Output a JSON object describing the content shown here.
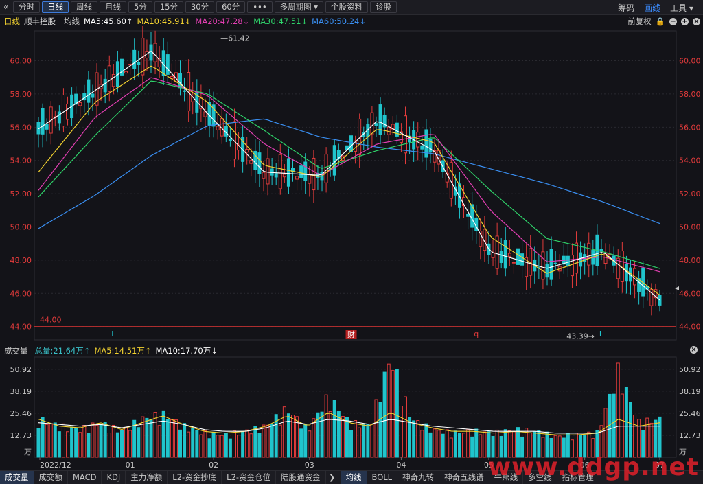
{
  "toolbar": {
    "tabs": [
      "分时",
      "日线",
      "周线",
      "月线",
      "5分",
      "15分",
      "30分",
      "60分",
      "•••",
      "多周期图 ▾",
      "个股资料",
      "诊股"
    ],
    "active_tab": 1,
    "right_items": [
      "筹码",
      "画线",
      "工具 ▾"
    ]
  },
  "header": {
    "period": "日线",
    "stock_name": "顺丰控股",
    "avg_label": "均线",
    "ma5": "MA5:45.60↑",
    "ma10": "MA10:45.91↓",
    "ma20": "MA20:47.28↓",
    "ma30": "MA30:47.51↓",
    "ma60": "MA60:50.24↓",
    "adjust": "前复权",
    "colors": {
      "ma5": "#ffffff",
      "ma10": "#f2d230",
      "ma20": "#e23fb2",
      "ma30": "#2fd36a",
      "ma60": "#3a8ff2"
    }
  },
  "volume_header": {
    "label": "成交量",
    "total": "总量:21.64万↑",
    "ma5": "MA5:14.51万↑",
    "ma10": "MA10:17.70万↓"
  },
  "chart_data": [
    {
      "type": "candlestick",
      "title": "顺丰控股 日线",
      "ylim": [
        43.2,
        61.8
      ],
      "y_ticks": [
        "44.00",
        "46.00",
        "48.00",
        "50.00",
        "52.00",
        "54.00",
        "56.00",
        "58.00",
        "60.00"
      ],
      "high_label": "61.42",
      "low_label": "43.39",
      "horizontal_line_label": "44.00",
      "markers": [
        "L",
        "财",
        "q",
        "L"
      ],
      "x_labels": [
        "2022/12",
        "01",
        "02",
        "03",
        "04",
        "05",
        "06",
        "07"
      ],
      "ma_keypoints": {
        "ma5": [
          55.9,
          58.2,
          60.6,
          56.8,
          53.3,
          53.1,
          56.4,
          54.6,
          48.5,
          47.5,
          48.5,
          45.6
        ],
        "ma10": [
          53.3,
          57.5,
          59.7,
          57.5,
          53.7,
          53.0,
          55.9,
          55.1,
          49.4,
          47.2,
          48.4,
          45.9
        ],
        "ma20": [
          52.2,
          56.6,
          59.0,
          57.9,
          55.0,
          53.1,
          55.0,
          55.6,
          51.0,
          47.9,
          48.2,
          47.3
        ],
        "ma30": [
          51.8,
          55.5,
          58.8,
          58.0,
          55.8,
          53.5,
          54.6,
          55.4,
          52.2,
          49.3,
          48.5,
          47.5
        ],
        "ma60": [
          49.9,
          51.9,
          54.3,
          56.1,
          56.5,
          55.4,
          54.8,
          54.4,
          53.5,
          52.6,
          51.5,
          50.2
        ]
      }
    },
    {
      "type": "bar",
      "title": "成交量",
      "unit": "万",
      "ylim": [
        0,
        58
      ],
      "y_ticks": [
        "50.92",
        "38.19",
        "25.46",
        "12.73"
      ],
      "volume_keypoints": [
        22,
        18,
        16,
        20,
        15,
        22,
        25,
        18,
        14,
        13,
        15,
        18,
        28,
        16,
        35,
        20,
        18,
        58,
        22,
        16,
        14,
        15,
        14,
        16,
        15,
        12,
        13,
        14,
        50,
        20,
        22
      ],
      "vol_ma5_keypoints": [
        22,
        18,
        17,
        20,
        16,
        20,
        24,
        19,
        15,
        14,
        15,
        18,
        24,
        18,
        26,
        20,
        18,
        26,
        20,
        17,
        15,
        15,
        14,
        15,
        14,
        13,
        13,
        14,
        22,
        18,
        20
      ],
      "vol_ma10_keypoints": [
        20,
        19,
        18,
        19,
        17,
        19,
        21,
        19,
        16,
        15,
        15,
        17,
        21,
        19,
        22,
        21,
        19,
        22,
        20,
        18,
        17,
        16,
        15,
        15,
        15,
        14,
        14,
        14,
        18,
        18,
        18
      ]
    }
  ],
  "bottom_tabs": {
    "left": [
      "成交量",
      "成交额",
      "MACD",
      "KDJ",
      "主力净额",
      "L2-资金抄底",
      "L2-资金仓位",
      "陆股通资金"
    ],
    "left_active": 0,
    "right": [
      "均线",
      "BOLL",
      "神奇九转",
      "神奇五线谱",
      "牛熊线",
      "多空线",
      "指标管理"
    ],
    "right_active": 0
  },
  "watermark": "www.ddgp.net"
}
